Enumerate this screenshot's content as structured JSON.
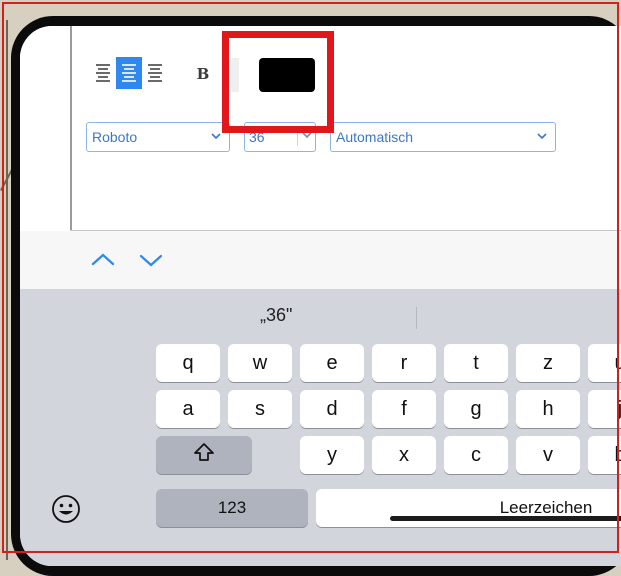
{
  "editor": {
    "alignment": {
      "options": [
        "left",
        "center",
        "right"
      ],
      "selected": "center"
    },
    "bold_label": "B",
    "text_color": "#000000",
    "font_select": {
      "value": "Roboto"
    },
    "size_input": {
      "value": "36"
    },
    "line_height_select": {
      "value": "Automatisch"
    }
  },
  "toolbar": {
    "prev_icon": "chevron-up-icon",
    "next_icon": "chevron-down-icon"
  },
  "keyboard": {
    "suggestion": "„36\"",
    "row1": [
      "q",
      "w",
      "e",
      "r",
      "t",
      "z",
      "u"
    ],
    "row2": [
      "a",
      "s",
      "d",
      "f",
      "g",
      "h",
      "j"
    ],
    "row3": [
      "y",
      "x",
      "c",
      "v",
      "b"
    ],
    "numbers_key": "123",
    "space_key": "Leerzeichen",
    "shift_icon": "shift-icon",
    "emoji_icon": "emoji-icon"
  },
  "colors": {
    "accent": "#2e88f0",
    "highlight_box": "#e0171b",
    "frame": "#d41f1f"
  }
}
